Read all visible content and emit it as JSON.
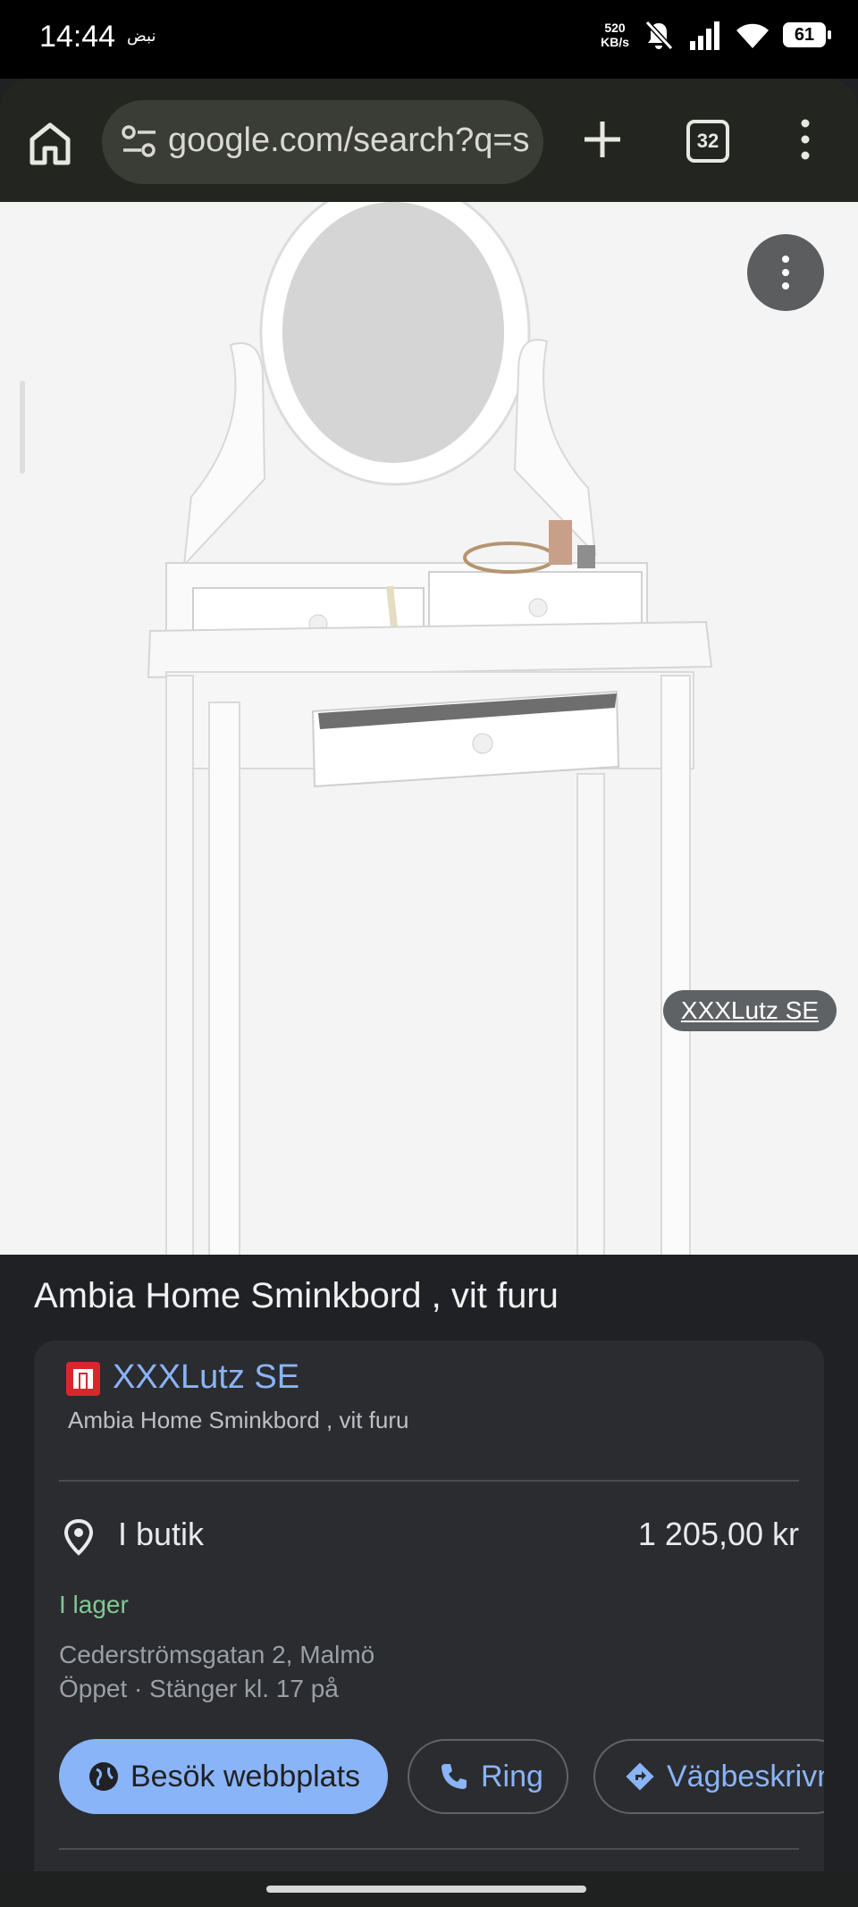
{
  "status": {
    "time": "14:44",
    "extra": "نبض",
    "net_speed_value": "520",
    "net_speed_unit": "KB/s",
    "battery": "61"
  },
  "browser": {
    "url": "google.com/search?q=s",
    "tab_count": "32",
    "icons": [
      "home-icon",
      "site-settings-icon",
      "new-tab-icon",
      "tab-switcher-icon",
      "more-vert-icon"
    ]
  },
  "image": {
    "source_chip": "XXXLutz SE"
  },
  "product": {
    "title": "Ambia Home Sminkbord , vit furu"
  },
  "seller": {
    "name": "XXXLutz SE",
    "subtitle": "Ambia Home Sminkbord , vit furu",
    "store_label": "I butik",
    "price": "1 205,00 kr",
    "stock": "I lager",
    "address": "Cederströmsgatan 2, Malmö",
    "hours": "Öppet · Stänger kl. 17 på",
    "buttons": {
      "visit": "Besök webbplats",
      "call": "Ring",
      "directions": "Vägbeskrivn"
    }
  },
  "colors": {
    "accent": "#8ab4f8",
    "stock_green": "#81c995",
    "card_bg": "#2b2c2f",
    "page_bg": "#202124"
  }
}
